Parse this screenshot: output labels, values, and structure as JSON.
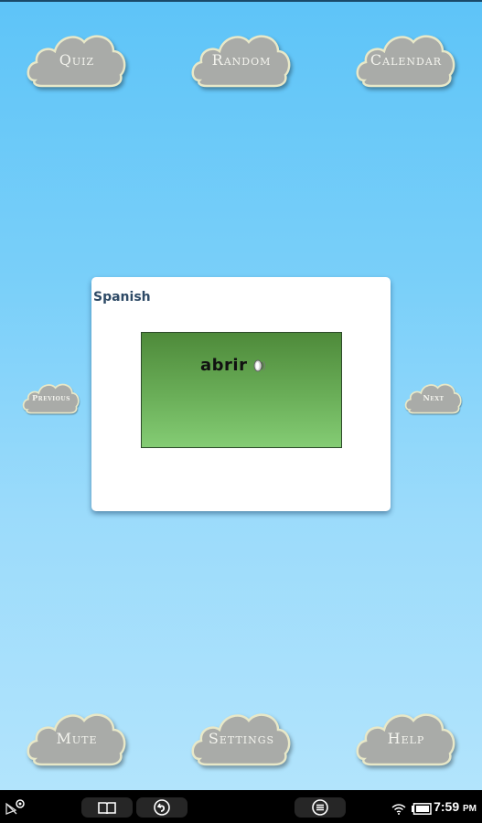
{
  "top_buttons": [
    {
      "label": "Quiz"
    },
    {
      "label": "Random"
    },
    {
      "label": "Calendar"
    }
  ],
  "side_buttons": {
    "previous": "Previous",
    "next": "Next"
  },
  "card": {
    "language": "Spanish",
    "word": "abrir",
    "audio_icon": "speaker-icon"
  },
  "bottom_buttons": [
    {
      "label": "Mute"
    },
    {
      "label": "Settings"
    },
    {
      "label": "Help"
    }
  ],
  "status_bar": {
    "notification_icon": "email-notification-icon",
    "nav_buttons": [
      "book-icon",
      "back-icon",
      "menu-icon"
    ],
    "wifi_icon": "wifi-icon",
    "battery_icon": "battery-icon",
    "time": "7:59",
    "ampm": "PM"
  },
  "colors": {
    "sky_top": "#5ec4f8",
    "sky_bottom": "#b2e4fc",
    "cloud_fill": "#a9aba8",
    "cloud_outline": "#e8e8c8",
    "card_green_top": "#4e8a3a",
    "card_green_bottom": "#84cc74",
    "title_color": "#2e4a66"
  }
}
